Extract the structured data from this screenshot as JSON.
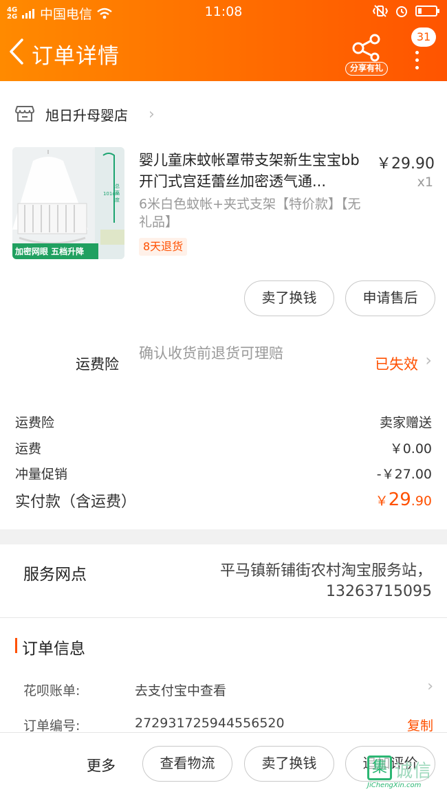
{
  "status_bar": {
    "network": "4G 2G",
    "carrier": "中国电信",
    "time": "11:08",
    "battery_level": 0.2
  },
  "header": {
    "back_icon": "chevron-left-icon",
    "title": "订单详情",
    "share_label": "分享有礼",
    "message_count": "31",
    "more_icon": "vertical-dots-icon",
    "bg_color": "#ff6a00"
  },
  "shop": {
    "icon": "store-icon",
    "name": "旭日升母婴店"
  },
  "product": {
    "title": "婴儿童床蚊帐罩带支架新生宝宝bb开门式宫廷蕾丝加密透气通...",
    "price": "￥29.90",
    "qty": "x1",
    "sku": "6米白色蚊帐+夹式支架【特价款】【无礼品】",
    "return_tag": "8天退货",
    "thumb": {
      "banner": "加密网眼 五档升降",
      "measure_1": "总高度",
      "measure_2": "101cm"
    }
  },
  "item_actions": {
    "sell": "卖了换钱",
    "aftersale": "申请售后"
  },
  "insurance": {
    "label": "运费险",
    "desc": "确认收货前退货可理赔",
    "status": "已失效"
  },
  "fees": [
    {
      "label": "运费险",
      "value": "卖家赠送"
    },
    {
      "label": "运费",
      "value": "￥0.00"
    },
    {
      "label": "冲量促销",
      "value": "-￥27.00"
    }
  ],
  "total": {
    "label": "实付款（含运费）",
    "symbol": "￥",
    "integer": "29",
    "decimal": ".90"
  },
  "service_point": {
    "label": "服务网点",
    "line1": "平马镇新铺街农村淘宝服务站，",
    "line2": "13263715095"
  },
  "order_info": {
    "title": "订单信息",
    "huabei_label": "花呗账单:",
    "huabei_value": "去支付宝中查看",
    "order_no_label": "订单编号:",
    "order_no_value": "272931725944556520",
    "copy_label": "复制"
  },
  "bottom_bar": {
    "more": "更多",
    "logistics": "查看物流",
    "sell": "卖了换钱",
    "review": "追加评价"
  },
  "watermark": {
    "mark": "集",
    "text": "诚信",
    "url": "JiChengXin.com"
  },
  "colors": {
    "accent": "#ff5000",
    "watermark": "#2bb673"
  }
}
